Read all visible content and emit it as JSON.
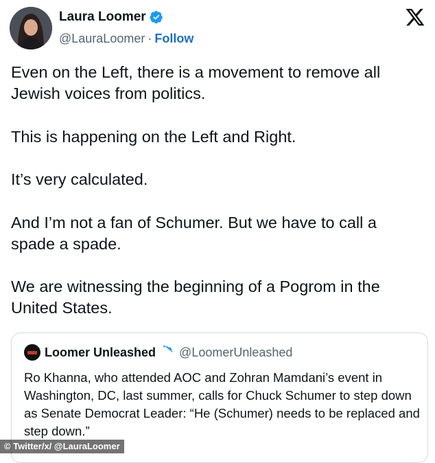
{
  "author": {
    "name": "Laura Loomer",
    "handle": "@LauraLoomer",
    "separator": "·",
    "follow_label": "Follow"
  },
  "tweet": {
    "paragraphs": [
      "Even on the Left, there is a movement to remove all\nJewish voices from politics.",
      "This is happening on the Left and Right.",
      "It’s very calculated.",
      "And I’m not a fan of Schumer. But we have to call a\nspade a spade.",
      "We are witnessing the beginning of a Pogrom in the\nUnited States."
    ]
  },
  "quote": {
    "name": "Loomer Unleashed",
    "handle": "@LoomerUnleashed",
    "text": "Ro Khanna, who attended AOC and Zohran Mamdani’s event in Washington, DC, last summer, calls for Chuck Schumer to step down as Senate Democrat Leader: “He (Schumer) needs to be replaced and step down.”"
  },
  "credit": "© Twitter/x/ @LauraLoomer",
  "colors": {
    "verified": "#1d9bf0",
    "follow": "#1d6fc2",
    "secondary_text": "#536471"
  },
  "icons": {
    "verified": "verified-badge-icon",
    "platform": "x-logo-icon"
  }
}
